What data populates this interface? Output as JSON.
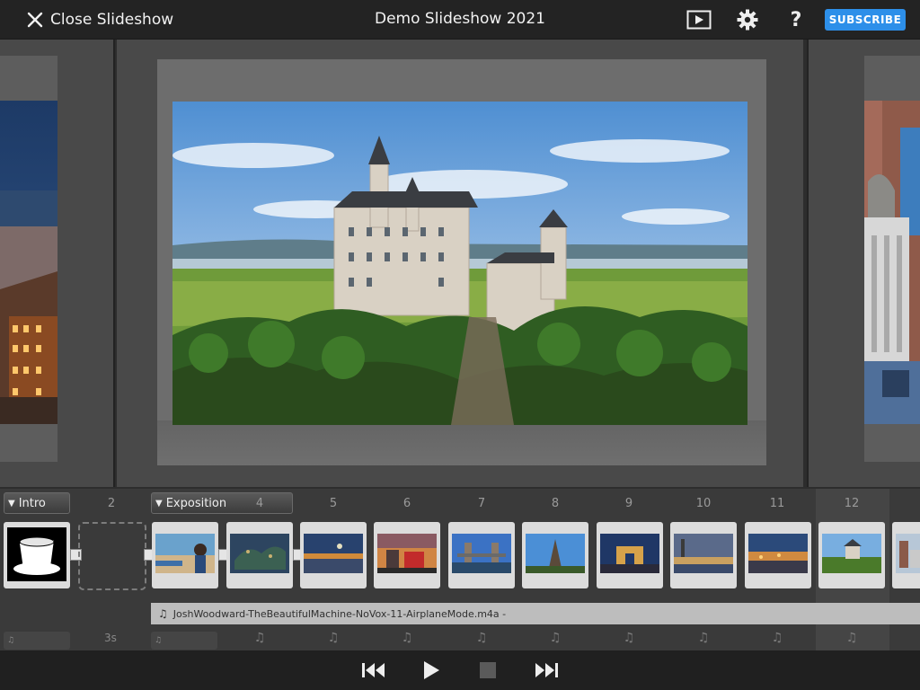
{
  "header": {
    "close_label": "Close Slideshow",
    "title": "Demo Slideshow 2021",
    "subscribe_label": "SUBSCRIBE",
    "help_label": "?",
    "icons": [
      "close-icon",
      "play-preview-icon",
      "gear-icon",
      "help-icon"
    ]
  },
  "timeline": {
    "sections": [
      {
        "label": "Intro"
      },
      {
        "label": "Exposition"
      }
    ],
    "slide_numbers": [
      "2",
      "4",
      "5",
      "6",
      "7",
      "8",
      "9",
      "10",
      "11",
      "12"
    ],
    "intro_duration": "3s",
    "audio_track": "JoshWoodward-TheBeautifulMachine-NoVox-11-AirplaneMode.m4a -",
    "note_glyph": "♫"
  },
  "controls": {
    "icons": [
      "skip-back-icon",
      "play-icon",
      "stop-icon",
      "skip-forward-icon"
    ]
  },
  "colors": {
    "accent": "#2d8fe9",
    "topbar": "#232323",
    "timeline": "#3a3a3a",
    "audio_bar": "#bdbdbd"
  }
}
